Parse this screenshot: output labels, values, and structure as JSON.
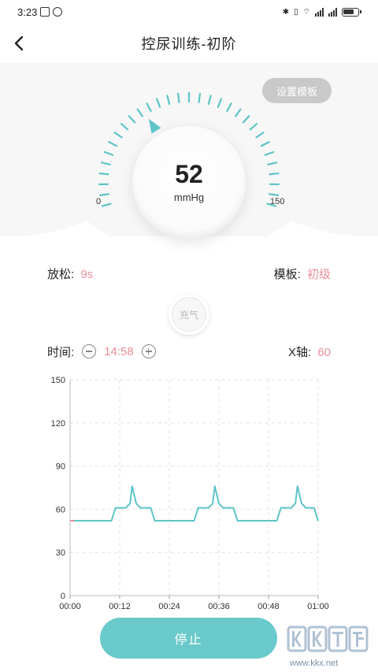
{
  "status_bar": {
    "time": "3:23"
  },
  "header": {
    "title": "控尿训练-初阶"
  },
  "gauge": {
    "template_button": "设置模板",
    "value": "52",
    "unit": "mmHg",
    "min_label": "0",
    "max_label": "150",
    "min": 0,
    "max": 150,
    "pointer_value": 52,
    "ticks": 31,
    "accent_color": "#5ec4c6"
  },
  "relax": {
    "label": "放松:",
    "value": "9s"
  },
  "template": {
    "label": "模板:",
    "value": "初级"
  },
  "inflate_button": "充气",
  "time": {
    "label": "时间:",
    "value": "14:58"
  },
  "xaxis": {
    "label": "X轴:",
    "value": "60"
  },
  "chart_data": {
    "type": "line",
    "xlabel": "",
    "ylabel": "",
    "x_ticks": [
      "00:00",
      "00:12",
      "00:24",
      "00:36",
      "00:48",
      "01:00"
    ],
    "y_ticks": [
      "0",
      "30",
      "60",
      "90",
      "120",
      "150"
    ],
    "xlim": [
      0,
      60
    ],
    "ylim": [
      0,
      150
    ],
    "grid": true,
    "series": [
      {
        "color": "#5ec4c6",
        "x": [
          0,
          10,
          11,
          13.5,
          14.5,
          15,
          16,
          17,
          19.5,
          20.5,
          30,
          31,
          33.5,
          34.5,
          35,
          36,
          37,
          39.5,
          40.5,
          50,
          51,
          53.5,
          54.5,
          55,
          56,
          57,
          59,
          60
        ],
        "y": [
          52,
          52,
          61,
          61,
          64,
          76,
          64,
          61,
          61,
          52,
          52,
          61,
          61,
          64,
          76,
          64,
          61,
          61,
          52,
          52,
          61,
          61,
          64,
          76,
          64,
          61,
          61,
          52
        ]
      },
      {
        "color": "#e8909a",
        "x": [
          0,
          1
        ],
        "y": [
          52,
          52
        ]
      }
    ]
  },
  "stop_button": "停止",
  "watermark": {
    "site": "www.kkx.net"
  }
}
